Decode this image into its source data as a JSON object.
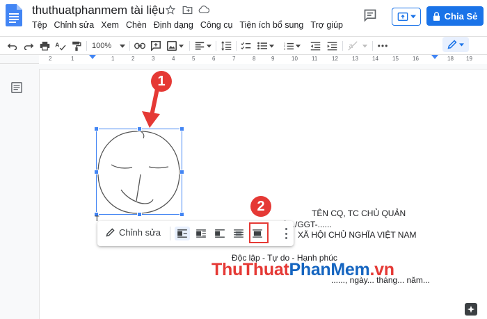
{
  "header": {
    "title": "thuthuatphanmem tài liệu",
    "menu": [
      "Tệp",
      "Chỉnh sửa",
      "Xem",
      "Chèn",
      "Định dạng",
      "Công cụ",
      "Tiện ích bổ sung",
      "Trợ giúp"
    ],
    "share_label": "Chia Sẻ",
    "brand_color": "#1a73e8"
  },
  "toolbar": {
    "zoom": "100%",
    "icons": [
      "undo-icon",
      "redo-icon",
      "print-icon",
      "spellcheck-icon",
      "paint-format-icon",
      "zoom-select",
      "link-icon",
      "comment-icon",
      "insert-image-icon",
      "align-icon",
      "line-spacing-icon",
      "checklist-icon",
      "bullet-list-icon",
      "numbered-list-icon",
      "decrease-indent-icon",
      "increase-indent-icon",
      "clear-format-icon",
      "more-icon",
      "edit-mode-icon"
    ]
  },
  "ruler": {
    "numbers": [
      "2",
      "1",
      "1",
      "2",
      "3",
      "4",
      "5",
      "6",
      "7",
      "8",
      "9",
      "10",
      "11",
      "12",
      "13",
      "14",
      "15",
      "16",
      "17",
      "18",
      "19"
    ]
  },
  "image_toolbar": {
    "edit_label": "Chỉnh sửa",
    "wrap_options": [
      "inline",
      "wrap-text",
      "break-text",
      "behind-text",
      "in-front-of-text"
    ],
    "active_option": "inline",
    "highlighted_option": "in-front-of-text"
  },
  "annotations": {
    "step1": "1",
    "step2": "2",
    "accent_color": "#e53935"
  },
  "document": {
    "line1": "TÊN CQ, TC CHỦ QUẢN",
    "line2": "Số:.../GGT-......",
    "line3": "XÃ HỘI CHỦ NGHĨA VIỆT NAM",
    "line4": "Độc lập - Tự do - Hạnh phúc",
    "line5": "......, ngày... tháng... năm...",
    "partial_left": "T"
  },
  "watermark": {
    "part1": "Thu",
    "part2": "Thuat",
    "part3": "PhanMem",
    "part4": ".vn"
  }
}
